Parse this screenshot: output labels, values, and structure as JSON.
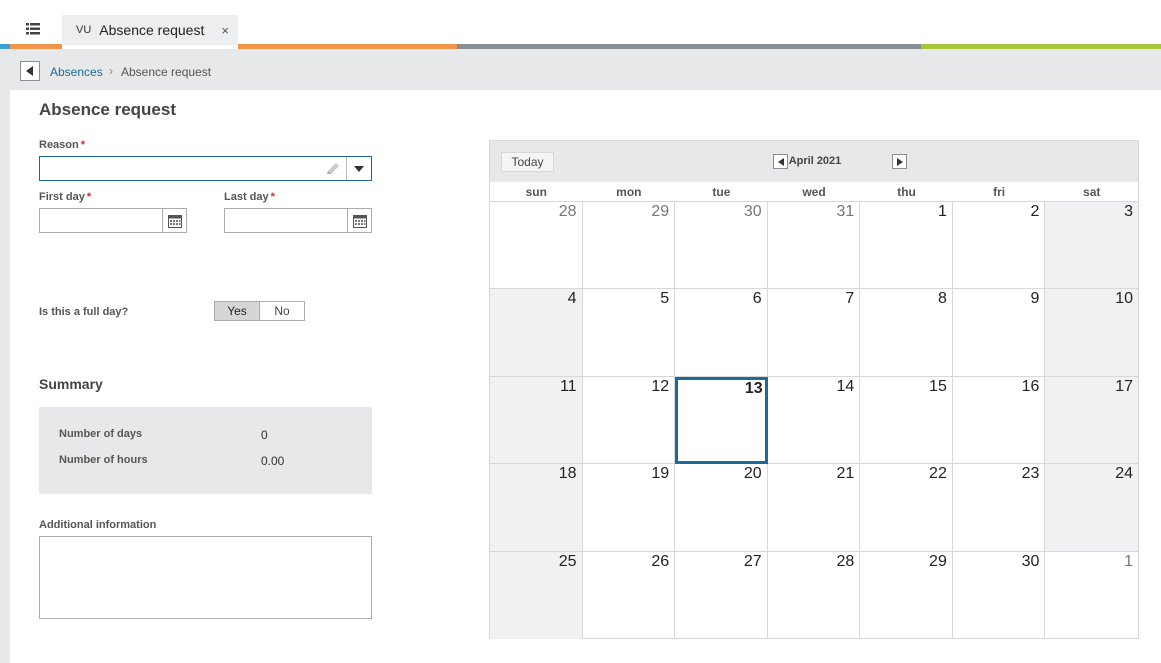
{
  "tab": {
    "badge": "VU",
    "title": "Absence request",
    "close": "×"
  },
  "breadcrumb": {
    "parent": "Absences",
    "separator": "›",
    "current": "Absence request"
  },
  "form": {
    "title": "Absence request",
    "reason_label": "Reason",
    "first_day_label": "First day",
    "last_day_label": "Last day",
    "required_mark": "*",
    "full_day_label": "Is this a full day?",
    "full_day_yes": "Yes",
    "full_day_no": "No",
    "full_day_selected": "Yes"
  },
  "summary": {
    "title": "Summary",
    "days_label": "Number of days",
    "days_value": "0",
    "hours_label": "Number of hours",
    "hours_value": "0.00"
  },
  "additional": {
    "label": "Additional information"
  },
  "calendar": {
    "today_label": "Today",
    "month": "April 2021",
    "weekdays": [
      "sun",
      "mon",
      "tue",
      "wed",
      "thu",
      "fri",
      "sat"
    ],
    "days": [
      "28",
      "29",
      "30",
      "31",
      "1",
      "2",
      "3",
      "4",
      "5",
      "6",
      "7",
      "8",
      "9",
      "10",
      "11",
      "12",
      "13",
      "14",
      "15",
      "16",
      "17",
      "18",
      "19",
      "20",
      "21",
      "22",
      "23",
      "24",
      "25",
      "26",
      "27",
      "28",
      "29",
      "30",
      "1"
    ],
    "today_date": "13"
  },
  "colors": {
    "accent": "#1d6a98",
    "required": "#d02b2b"
  },
  "icons": {
    "menu": "list-menu-icon",
    "back": "triangle-left-icon",
    "calendar": "calendar-icon",
    "pencil": "pencil-icon",
    "dropdown": "chevron-down-icon"
  }
}
